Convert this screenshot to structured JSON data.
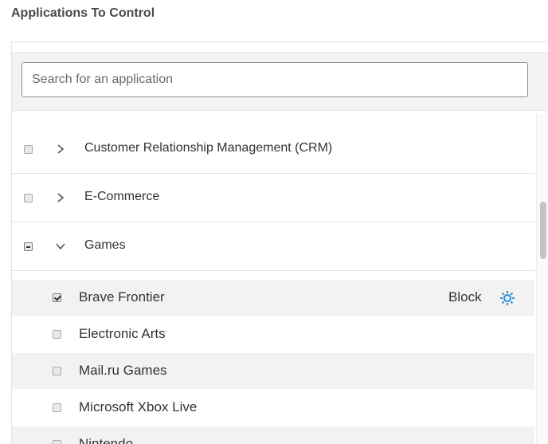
{
  "section": {
    "title": "Applications To Control"
  },
  "search": {
    "placeholder": "Search for an application",
    "value": ""
  },
  "categories": [
    {
      "label": "Customer Relationship Management (CRM)",
      "state": "unchecked",
      "expanded": false
    },
    {
      "label": "E-Commerce",
      "state": "unchecked",
      "expanded": false
    },
    {
      "label": "Games",
      "state": "indeterminate",
      "expanded": true
    }
  ],
  "games_apps": [
    {
      "label": "Brave Frontier",
      "checked": true,
      "action": "Block"
    },
    {
      "label": "Electronic Arts",
      "checked": false,
      "action": ""
    },
    {
      "label": "Mail.ru Games",
      "checked": false,
      "action": ""
    },
    {
      "label": "Microsoft Xbox Live",
      "checked": false,
      "action": ""
    },
    {
      "label": "Nintendo",
      "checked": false,
      "action": ""
    }
  ],
  "colors": {
    "gear": "#2b8fd6",
    "shaded_row": "#f2f2f2",
    "divider": "#e2e2e2"
  },
  "icons": {
    "collapsed": "chevron-right-icon",
    "expanded": "chevron-down-icon",
    "settings": "gear-icon"
  }
}
